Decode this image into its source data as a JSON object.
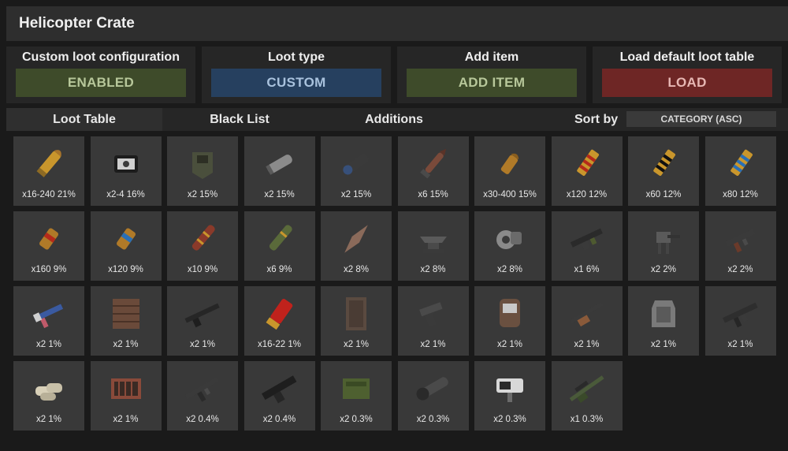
{
  "window": {
    "title": "Helicopter Crate"
  },
  "panels": [
    {
      "label": "Custom loot configuration",
      "button": "ENABLED",
      "color": "#3e4b2a"
    },
    {
      "label": "Loot type",
      "button": "CUSTOM",
      "color": "#26405f"
    },
    {
      "label": "Add item",
      "button": "ADD ITEM",
      "color": "#3e4b2a"
    },
    {
      "label": "Load default loot table",
      "button": "LOAD",
      "color": "#6e2625"
    }
  ],
  "tabs": [
    {
      "label": "Loot Table",
      "active": true
    },
    {
      "label": "Black List",
      "active": false
    },
    {
      "label": "Additions",
      "active": false
    }
  ],
  "sort": {
    "label": "Sort by",
    "value": "CATEGORY (ASC)"
  },
  "items": [
    {
      "caption": "x16-240 21%",
      "icon": "rifle-ammo-icon"
    },
    {
      "caption": "x2-4 16%",
      "icon": "explosive-charge-icon"
    },
    {
      "caption": "x2 15%",
      "icon": "armor-plate-icon"
    },
    {
      "caption": "x2 15%",
      "icon": "pipe-icon"
    },
    {
      "caption": "x2 15%",
      "icon": "scope-icon"
    },
    {
      "caption": "x6 15%",
      "icon": "rocket-icon"
    },
    {
      "caption": "x30-400 15%",
      "icon": "pistol-ammo-icon"
    },
    {
      "caption": "x120 12%",
      "icon": "incendiary-ammo-icon"
    },
    {
      "caption": "x60 12%",
      "icon": "explosive-ammo-icon"
    },
    {
      "caption": "x80 12%",
      "icon": "hv-ammo-icon"
    },
    {
      "caption": "x160 9%",
      "icon": "incendiary-pistol-ammo-icon"
    },
    {
      "caption": "x120 9%",
      "icon": "hv-pistol-ammo-icon"
    },
    {
      "caption": "x10 9%",
      "icon": "incendiary-rocket-icon"
    },
    {
      "caption": "x6 9%",
      "icon": "hv-rocket-icon"
    },
    {
      "caption": "x2 8%",
      "icon": "blade-icon"
    },
    {
      "caption": "x2 8%",
      "icon": "anvil-icon"
    },
    {
      "caption": "x2 8%",
      "icon": "engine-part-icon"
    },
    {
      "caption": "x1 6%",
      "icon": "lmg-icon"
    },
    {
      "caption": "x2 2%",
      "icon": "turret-icon"
    },
    {
      "caption": "x2 2%",
      "icon": "smg-icon"
    },
    {
      "caption": "x2 1%",
      "icon": "toy-gun-icon"
    },
    {
      "caption": "x2 1%",
      "icon": "garage-door-icon"
    },
    {
      "caption": "x2 1%",
      "icon": "shotgun-icon"
    },
    {
      "caption": "x16-22 1%",
      "icon": "shotgun-shell-icon"
    },
    {
      "caption": "x2 1%",
      "icon": "metal-door-icon"
    },
    {
      "caption": "x2 1%",
      "icon": "pistol-icon"
    },
    {
      "caption": "x2 1%",
      "icon": "facemask-icon"
    },
    {
      "caption": "x2 1%",
      "icon": "bolt-rifle-icon"
    },
    {
      "caption": "x2 1%",
      "icon": "chest-plate-icon"
    },
    {
      "caption": "x2 1%",
      "icon": "assault-rifle-icon"
    },
    {
      "caption": "x2 1%",
      "icon": "sandbag-icon"
    },
    {
      "caption": "x2 1%",
      "icon": "window-bars-icon"
    },
    {
      "caption": "x2 0.4%",
      "icon": "ak-rifle-icon"
    },
    {
      "caption": "x2 0.4%",
      "icon": "m249-icon"
    },
    {
      "caption": "x2 0.3%",
      "icon": "ammo-crate-icon"
    },
    {
      "caption": "x2 0.3%",
      "icon": "launcher-icon"
    },
    {
      "caption": "x2 0.3%",
      "icon": "camera-icon"
    },
    {
      "caption": "x1 0.3%",
      "icon": "sniper-rifle-icon"
    }
  ]
}
